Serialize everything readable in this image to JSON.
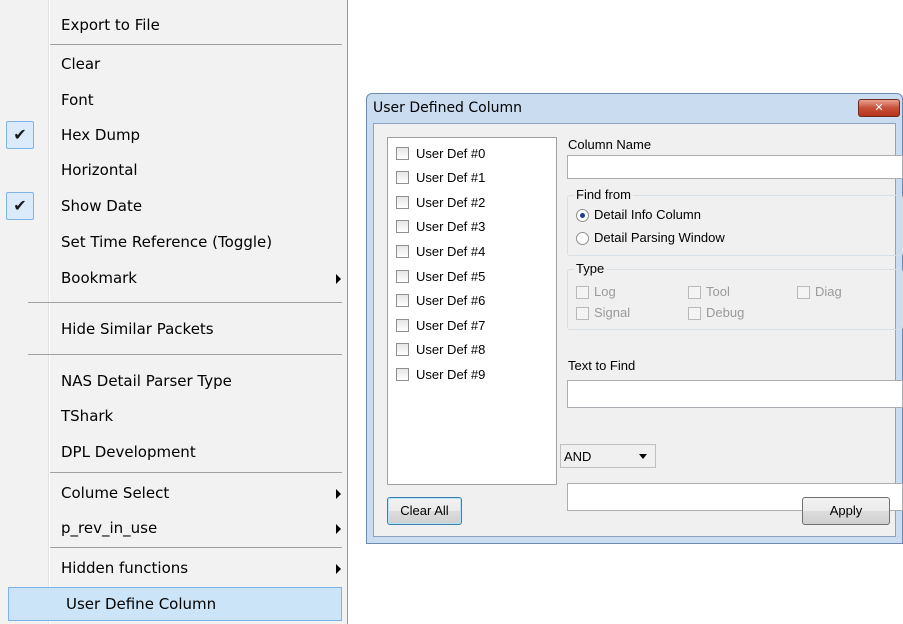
{
  "menu": {
    "items": [
      {
        "label": "Export to File",
        "checked": false,
        "submenu": false
      },
      {
        "label": "Clear",
        "checked": false,
        "submenu": false
      },
      {
        "label": "Font",
        "checked": false,
        "submenu": false
      },
      {
        "label": "Hex Dump",
        "checked": true,
        "submenu": false
      },
      {
        "label": "Horizontal",
        "checked": false,
        "submenu": false
      },
      {
        "label": "Show Date",
        "checked": true,
        "submenu": false
      },
      {
        "label": "Set Time Reference (Toggle)",
        "checked": false,
        "submenu": false
      },
      {
        "label": "Bookmark",
        "checked": false,
        "submenu": true
      },
      {
        "label": "Hide Similar Packets",
        "checked": false,
        "submenu": false
      },
      {
        "label": "NAS Detail Parser Type",
        "checked": false,
        "submenu": false
      },
      {
        "label": "TShark",
        "checked": false,
        "submenu": false
      },
      {
        "label": "DPL Development",
        "checked": false,
        "submenu": false
      },
      {
        "label": "Colume Select",
        "checked": false,
        "submenu": true
      },
      {
        "label": "p_rev_in_use",
        "checked": false,
        "submenu": true
      },
      {
        "label": "Hidden functions",
        "checked": false,
        "submenu": true
      },
      {
        "label": "User Define Column",
        "checked": false,
        "submenu": false,
        "selected": true
      }
    ],
    "check_glyph": "✔"
  },
  "dialog": {
    "title": "User Defined Column",
    "close_glyph": "✕",
    "user_defs": [
      "User Def #0",
      "User Def #1",
      "User Def #2",
      "User Def #3",
      "User Def #4",
      "User Def #5",
      "User Def #6",
      "User Def #7",
      "User Def #8",
      "User Def #9"
    ],
    "column_name_label": "Column Name",
    "column_name_value": "",
    "find_from": {
      "label": "Find from",
      "options": [
        "Detail Info Column",
        "Detail Parsing Window"
      ],
      "selected": "Detail Info Column"
    },
    "type": {
      "label": "Type",
      "options": [
        "Log",
        "Tool",
        "Diag",
        "Signal",
        "Debug"
      ]
    },
    "text_to_find_label": "Text to Find",
    "text_to_find_value": "",
    "operator": "AND",
    "second_text_value": "",
    "clear_all_label": "Clear All",
    "apply_label": "Apply"
  }
}
